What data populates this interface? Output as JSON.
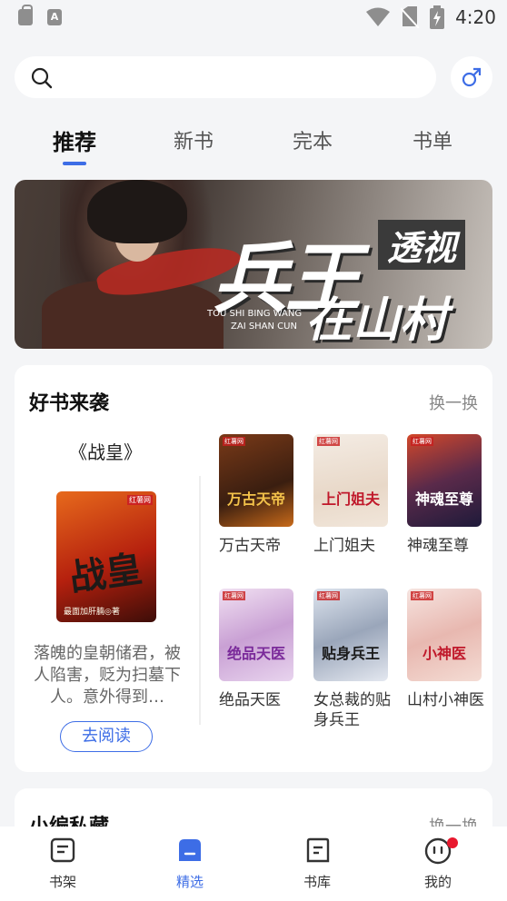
{
  "status_bar": {
    "time": "4:20"
  },
  "search": {
    "placeholder": ""
  },
  "tabs": [
    {
      "label": "推荐",
      "active": true
    },
    {
      "label": "新书",
      "active": false
    },
    {
      "label": "完本",
      "active": false
    },
    {
      "label": "书单",
      "active": false
    }
  ],
  "banner": {
    "title_big": "兵王",
    "title_mid": "透视",
    "title_low": "在山村",
    "subtitle_en1": "TOU SHI BING WANG",
    "subtitle_en2": "ZAI SHAN CUN"
  },
  "good_books": {
    "title": "好书来袭",
    "refresh_label": "换一换",
    "featured": {
      "title": "《战皇》",
      "cover_text": "战皇",
      "cover_author": "最面加肝腩◎著",
      "cover_brand": "红薯网",
      "description": "落魄的皇朝储君，被人陷害，贬为扫墓下人。意外得到…",
      "read_button": "去阅读"
    },
    "books": [
      {
        "name": "万古天帝",
        "cover_text": "万古天帝",
        "tag": "红薯网"
      },
      {
        "name": "上门姐夫",
        "cover_text": "上门姐夫",
        "tag": "红薯网"
      },
      {
        "name": "神魂至尊",
        "cover_text": "神魂至尊",
        "tag": "红薯网"
      },
      {
        "name": "绝品天医",
        "cover_text": "绝品天医",
        "tag": "红薯网"
      },
      {
        "name": "女总裁的贴身兵王",
        "cover_text": "贴身兵王",
        "tag": "红薯网"
      },
      {
        "name": "山村小神医",
        "cover_text": "小神医",
        "tag": "红薯网"
      }
    ]
  },
  "editor_picks": {
    "title": "小编私藏",
    "refresh_label": "换一换"
  },
  "bottom_nav": [
    {
      "label": "书架",
      "icon": "bookshelf-icon",
      "active": false
    },
    {
      "label": "精选",
      "icon": "featured-icon",
      "active": true
    },
    {
      "label": "书库",
      "icon": "library-icon",
      "active": false
    },
    {
      "label": "我的",
      "icon": "profile-icon",
      "active": false,
      "badge": true
    }
  ],
  "colors": {
    "accent": "#3d6de6",
    "badge": "#e8182e",
    "background": "#f4f5f7"
  }
}
